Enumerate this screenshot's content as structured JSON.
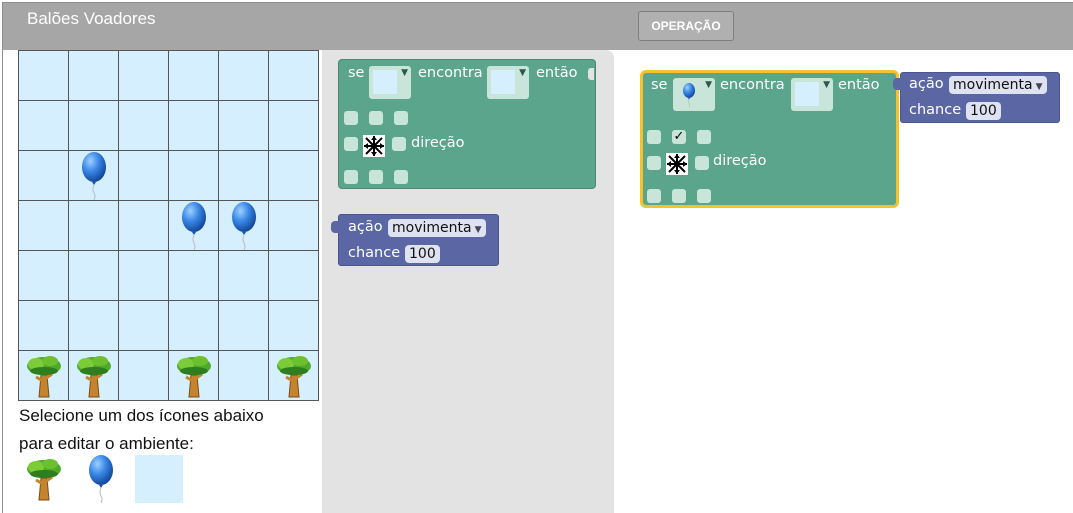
{
  "app": {
    "title": "Balões Voadores",
    "operation_button": "OPERAÇÃO"
  },
  "grid": {
    "rows": 7,
    "cols": 6,
    "cells": [
      [
        "",
        "",
        "",
        "",
        "",
        ""
      ],
      [
        "",
        "",
        "",
        "",
        "",
        ""
      ],
      [
        "",
        "balloon",
        "",
        "",
        "",
        ""
      ],
      [
        "",
        "",
        "",
        "balloon",
        "balloon",
        ""
      ],
      [
        "",
        "",
        "",
        "",
        "",
        ""
      ],
      [
        "",
        "",
        "",
        "",
        "",
        ""
      ],
      [
        "tree",
        "tree",
        "",
        "tree",
        "",
        "tree"
      ]
    ],
    "colors": {
      "cell": "#d6efff",
      "lines": "#555555"
    }
  },
  "instructions": {
    "line1": "Selecione um dos ícones abaixo",
    "line2": "para editar o ambiente:"
  },
  "palette": {
    "items": [
      "tree-icon",
      "balloon-icon",
      "empty-cell"
    ]
  },
  "toolbox": {
    "rule_block": {
      "if": "se",
      "finds": "encontra",
      "then": "então",
      "direction": "direção"
    },
    "action_block": {
      "action": "ação",
      "action_value": "movimenta",
      "chance": "chance",
      "chance_value": "100"
    }
  },
  "workspace": {
    "rule_block": {
      "if": "se",
      "finds": "encontra",
      "then": "então",
      "direction": "direção",
      "check": "✓",
      "selected_icon": "balloon-icon"
    },
    "action_block": {
      "action": "ação",
      "action_value": "movimenta",
      "chance": "chance",
      "chance_value": "100"
    }
  },
  "colors": {
    "header": "#a6a6a6",
    "block_green": "#5ba58c",
    "block_blue": "#5b67a5",
    "selected_outline": "#f2c230"
  }
}
